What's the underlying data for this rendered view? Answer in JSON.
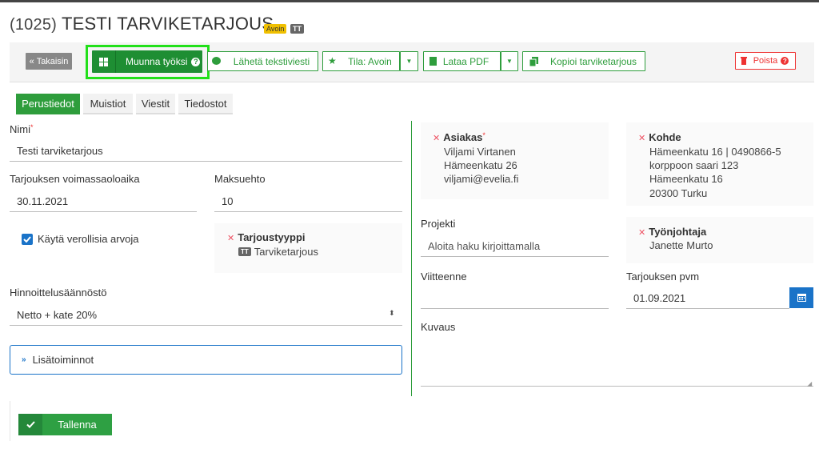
{
  "header": {
    "number": "(1025)",
    "title": "TESTI TARVIKETARJOUS",
    "status_badge": "Avoin",
    "type_badge": "TT"
  },
  "toolbar": {
    "back_label": "Takaisin",
    "convert_label": "Muunna työksi",
    "sms_label": "Lähetä tekstiviesti",
    "state_label": "Tila: Avoin",
    "pdf_label": "Lataa PDF",
    "copy_label": "Kopioi tarviketarjous",
    "delete_label": "Poista"
  },
  "tabs": [
    {
      "label": "Perustiedot",
      "active": true
    },
    {
      "label": "Muistiot",
      "active": false
    },
    {
      "label": "Viestit",
      "active": false
    },
    {
      "label": "Tiedostot",
      "active": false
    }
  ],
  "form": {
    "name_label": "Nimi",
    "name_value": "Testi tarviketarjous",
    "validity_label": "Tarjouksen voimassaoloaika",
    "validity_value": "30.11.2021",
    "payment_label": "Maksuehto",
    "payment_value": "10",
    "tax_checkbox_label": "Käytä verollisia arvoja",
    "tax_checked": true,
    "offer_type_label": "Tarjoustyyppi",
    "offer_type_badge": "TT",
    "offer_type_value": "Tarviketarjous",
    "pricing_label": "Hinnoittelusäännöstö",
    "pricing_value": "Netto + kate 20%",
    "more_label": "Lisätoiminnot"
  },
  "customer": {
    "label": "Asiakas",
    "name": "Viljami Virtanen",
    "address": "Hämeenkatu 26",
    "email": "viljami@evelia.fi"
  },
  "target": {
    "label": "Kohde",
    "line1": "Hämeenkatu 16 | 0490866-5",
    "line2": "korppoon saari 123",
    "line3": "Hämeenkatu 16",
    "line4": "20300 Turku"
  },
  "project": {
    "label": "Projekti",
    "placeholder": "Aloita haku kirjoittamalla"
  },
  "supervisor": {
    "label": "Työnjohtaja",
    "name": "Janette Murto"
  },
  "reference": {
    "label": "Viitteenne",
    "value": ""
  },
  "offer_date": {
    "label": "Tarjouksen pvm",
    "value": "01.09.2021"
  },
  "description": {
    "label": "Kuvaus",
    "value": ""
  },
  "save_label": "Tallenna",
  "colors": {
    "green": "#2e9d3c",
    "blue": "#1a73c8",
    "red": "#e33333",
    "highlight": "#22e01a"
  }
}
